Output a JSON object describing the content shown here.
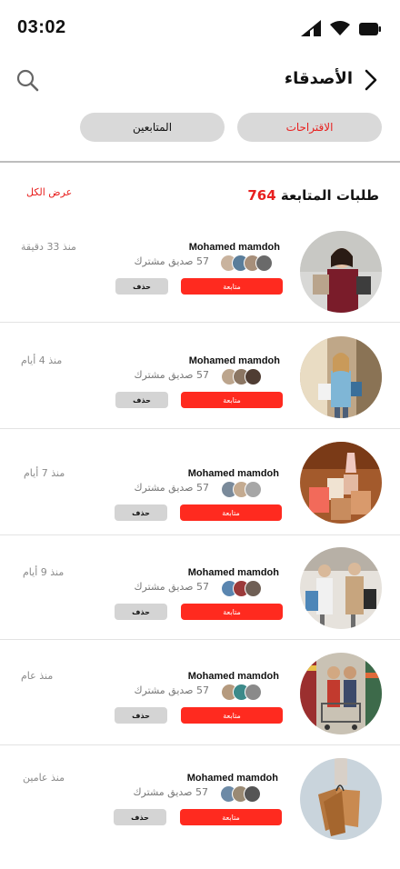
{
  "status": {
    "time": "03:02"
  },
  "header": {
    "title": "الأصدقاء"
  },
  "tabs": [
    {
      "label": "الاقتراحات",
      "active": true
    },
    {
      "label": "المتابعين",
      "active": false
    }
  ],
  "section": {
    "title": "طلبات المتابعة",
    "count": "764",
    "view_all": "عرض الكل"
  },
  "requests": [
    {
      "name": "Mohamed mamdoh",
      "mutual": "57 صديق مشترك",
      "follow_label": "متابعة",
      "delete_label": "حذف",
      "time": "منذ 33 دقيقة",
      "photo": "woman-shopping-bags"
    },
    {
      "name": "Mohamed mamdoh",
      "mutual": "57 صديق مشترك",
      "follow_label": "متابعة",
      "delete_label": "حذف",
      "time": "منذ 4 أيام",
      "photo": "woman-in-mall"
    },
    {
      "name": "Mohamed mamdoh",
      "mutual": "57 صديق مشترك",
      "follow_label": "متابعة",
      "delete_label": "حذف",
      "time": "منذ 7 أيام",
      "photo": "shopping-bags-pile"
    },
    {
      "name": "Mohamed mamdoh",
      "mutual": "57 صديق مشترك",
      "follow_label": "متابعة",
      "delete_label": "حذف",
      "time": "منذ 9 أيام",
      "photo": "couple-shopping"
    },
    {
      "name": "Mohamed mamdoh",
      "mutual": "57 صديق مشترك",
      "follow_label": "متابعة",
      "delete_label": "حذف",
      "time": "منذ عام",
      "photo": "supermarket-couple"
    },
    {
      "name": "Mohamed mamdoh",
      "mutual": "57 صديق مشترك",
      "follow_label": "متابعة",
      "delete_label": "حذف",
      "time": "منذ عامين",
      "photo": "hand-with-bags"
    }
  ],
  "colors": {
    "accent": "#ff2a1f",
    "text_accent": "#e8201f",
    "chip": "#d9d9d9"
  }
}
